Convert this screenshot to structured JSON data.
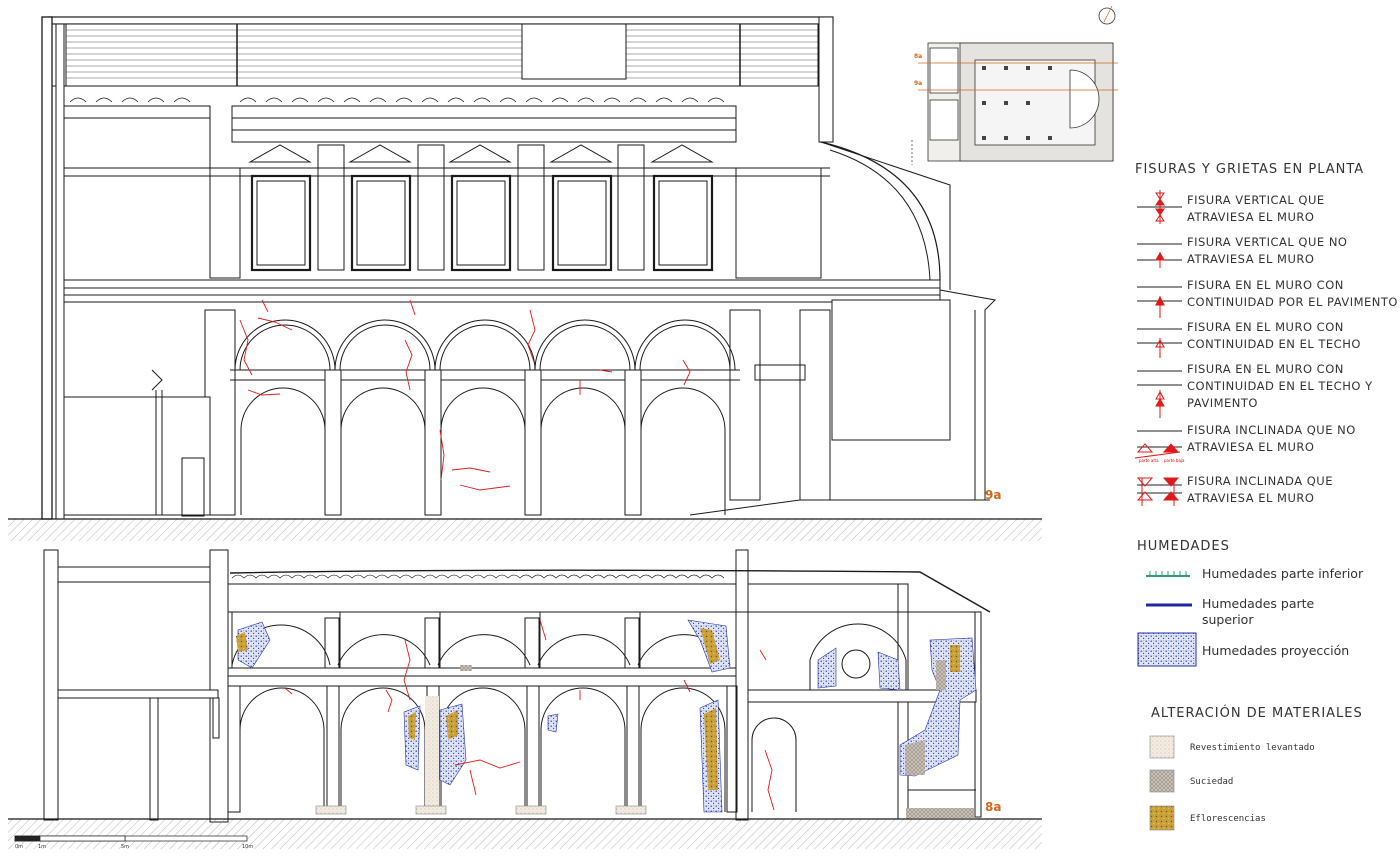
{
  "sections": {
    "upper_label": "9a",
    "lower_label": "8a"
  },
  "key_plan": {
    "label_top": "8a",
    "label_bottom": "9a"
  },
  "scale_bar": {
    "ticks": [
      "0m",
      "1m",
      "5m",
      "10m"
    ]
  },
  "legend_cracks": {
    "title": "FISURAS Y GRIETAS EN PLANTA",
    "items": [
      {
        "line1": "FISURA VERTICAL QUE",
        "line2": "ATRAVIESA EL MURO"
      },
      {
        "line1": "FISURA VERTICAL QUE NO",
        "line2": "ATRAVIESA EL MURO"
      },
      {
        "line1": "FISURA EN EL MURO CON",
        "line2": "CONTINUIDAD POR EL PAVIMENTO"
      },
      {
        "line1": "FISURA EN EL MURO CON",
        "line2": "CONTINUIDAD EN EL TECHO"
      },
      {
        "line1": "FISURA EN EL MURO CON",
        "line2": "CONTINUIDAD EN EL TECHO Y",
        "line3": "PAVIMENTO"
      },
      {
        "line1": "FISURA INCLINADA QUE NO",
        "line2": "ATRAVIESA EL MURO",
        "tag_a": "parte alta",
        "tag_b": "parte baja"
      },
      {
        "line1": "FISURA INCLINADA QUE",
        "line2": "ATRAVIESA EL MURO"
      }
    ]
  },
  "legend_humidity": {
    "title": "HUMEDADES",
    "items": [
      {
        "label": "Humedades parte inferior",
        "color": "#2e9e6e"
      },
      {
        "label_line1": "Humedades parte",
        "label_line2": "superior",
        "color": "#1b2a9e"
      },
      {
        "label": "Humedades proyección",
        "color": "#2233aa"
      }
    ]
  },
  "legend_materials": {
    "title": "ALTERACIÓN DE MATERIALES",
    "items": [
      {
        "label": "Revestimiento levantado",
        "color": "#e8ddd0"
      },
      {
        "label": "Suciedad",
        "color": "#b0a89c"
      },
      {
        "label": "Eflorescencias",
        "color": "#c9a03a"
      }
    ]
  },
  "colors": {
    "crack": "#e01a1a",
    "line": "#1a1a1a",
    "label_orange": "#d4661c",
    "damp_blue": "#2233aa",
    "efflorescence": "#c9a03a",
    "dirt": "#a89f92"
  }
}
